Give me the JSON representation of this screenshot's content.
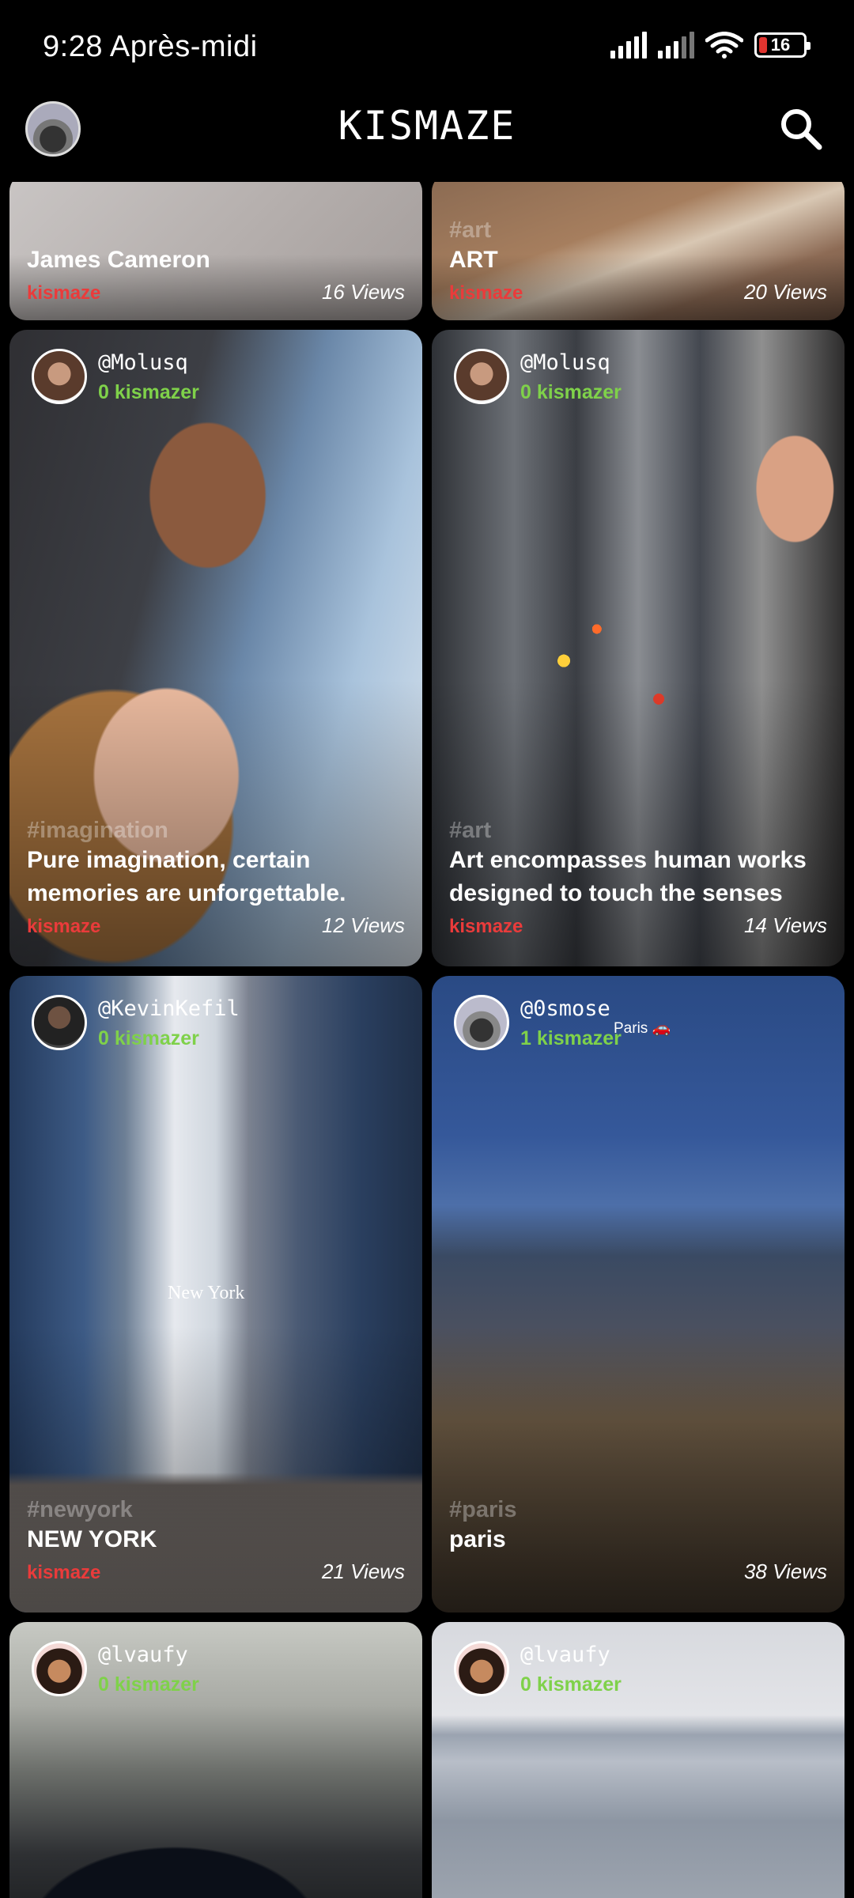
{
  "status_bar": {
    "time": "9:28 Après-midi",
    "battery": "16"
  },
  "app": {
    "title": "KISMAZE"
  },
  "icons": {
    "search": "search-icon",
    "wifi": "wifi-icon",
    "battery": "battery-icon",
    "signal": "signal-icon"
  },
  "colors": {
    "kismazer_count": "#7fd14a",
    "brand_label": "#ea3b3b",
    "background": "#000000"
  },
  "feed": [
    {
      "author": "",
      "kismazer": "",
      "tag": "",
      "caption": "James Cameron",
      "brand": "kismaze",
      "views": "16 Views"
    },
    {
      "author": "",
      "kismazer": "",
      "tag": "#art",
      "caption": "ART",
      "brand": "kismaze",
      "views": "20 Views"
    },
    {
      "author": "@Molusq",
      "kismazer": "0 kismazer",
      "tag": "#imagination",
      "caption": "Pure imagination, certain memories are unforgettable.",
      "brand": "kismaze",
      "views": "12 Views"
    },
    {
      "author": "@Molusq",
      "kismazer": "0 kismazer",
      "tag": "#art",
      "caption": "Art encompasses human works designed to touch the senses",
      "brand": "kismaze",
      "views": "14 Views"
    },
    {
      "author": "@KevinKefil",
      "kismazer": "0 kismazer",
      "location": "New York",
      "tag": "#newyork",
      "caption": "NEW YORK",
      "brand": "kismaze",
      "views": "21 Views"
    },
    {
      "author": "@0smose",
      "kismazer": "1 kismazer",
      "location": "Paris 🚗",
      "tag": "#paris",
      "caption": "paris",
      "brand": "",
      "views": "38 Views"
    },
    {
      "author": "@lvaufy",
      "kismazer": "0 kismazer"
    },
    {
      "author": "@lvaufy",
      "kismazer": "0 kismazer"
    }
  ]
}
